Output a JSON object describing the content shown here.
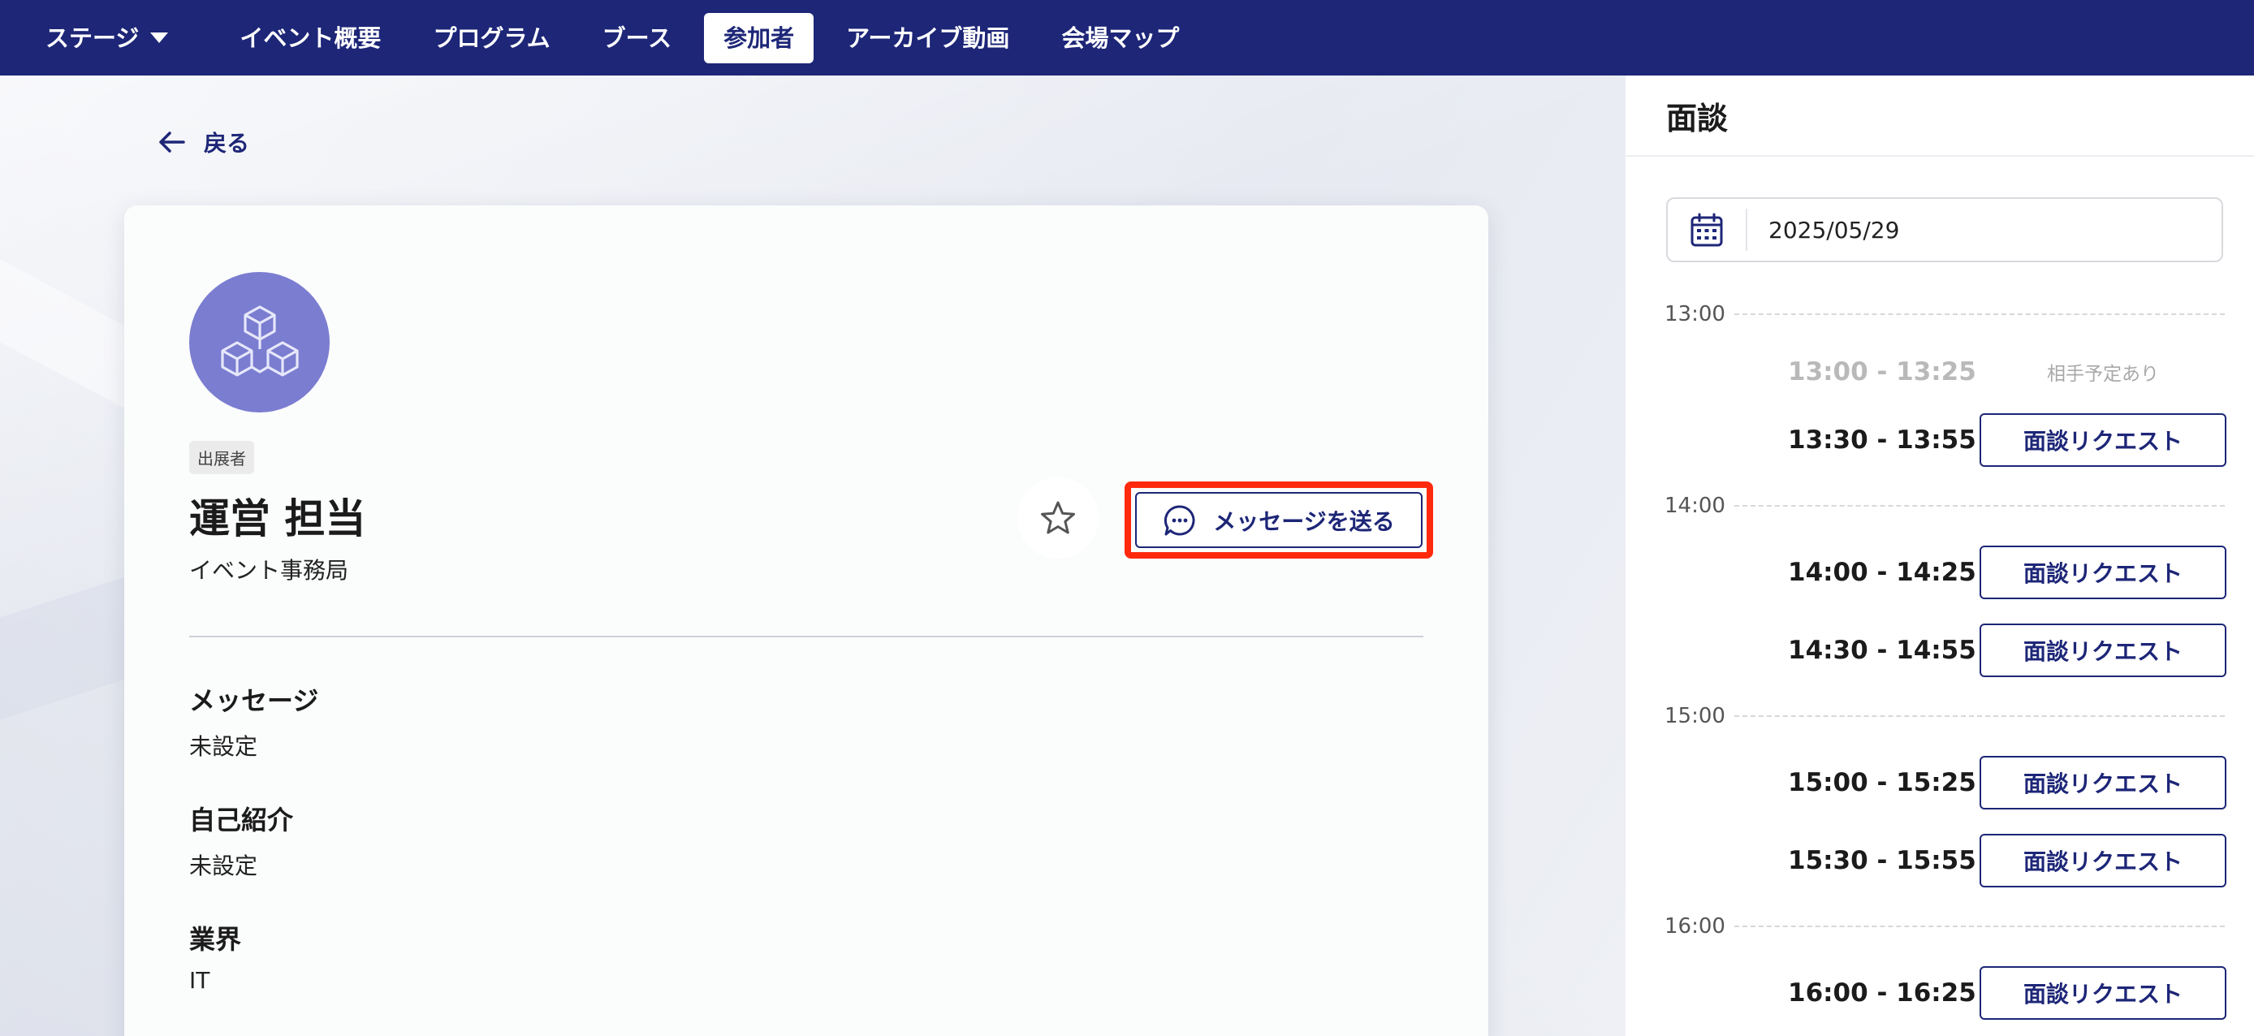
{
  "nav": {
    "items": [
      {
        "label": "ステージ",
        "dropdown": true
      },
      {
        "label": "イベント概要"
      },
      {
        "label": "プログラム"
      },
      {
        "label": "ブース"
      },
      {
        "label": "参加者",
        "active": true
      },
      {
        "label": "アーカイブ動画"
      },
      {
        "label": "会場マップ"
      }
    ]
  },
  "back": {
    "label": "戻る"
  },
  "profile": {
    "role_badge": "出展者",
    "name": "運営 担当",
    "organization": "イベント事務局",
    "send_message_label": "メッセージを送る",
    "fields": [
      {
        "label": "メッセージ",
        "value": "未設定"
      },
      {
        "label": "自己紹介",
        "value": "未設定"
      },
      {
        "label": "業界",
        "value": "IT"
      }
    ]
  },
  "meeting_panel": {
    "title": "面談",
    "date": "2025/05/29",
    "hours": [
      "13:00",
      "14:00",
      "15:00",
      "16:00"
    ],
    "slots": [
      {
        "time": "13:00 - 13:25",
        "status": "busy",
        "status_label": "相手予定あり"
      },
      {
        "time": "13:30 - 13:55",
        "status": "available",
        "action_label": "面談リクエスト"
      },
      {
        "time": "14:00 - 14:25",
        "status": "available",
        "action_label": "面談リクエスト"
      },
      {
        "time": "14:30 - 14:55",
        "status": "available",
        "action_label": "面談リクエスト"
      },
      {
        "time": "15:00 - 15:25",
        "status": "available",
        "action_label": "面談リクエスト"
      },
      {
        "time": "15:30 - 15:55",
        "status": "available",
        "action_label": "面談リクエスト"
      },
      {
        "time": "16:00 - 16:25",
        "status": "available",
        "action_label": "面談リクエスト"
      }
    ]
  },
  "colors": {
    "brand_navy": "#1d2677",
    "avatar_purple": "#7a7dd0",
    "highlight_red": "#ff2a0e"
  }
}
